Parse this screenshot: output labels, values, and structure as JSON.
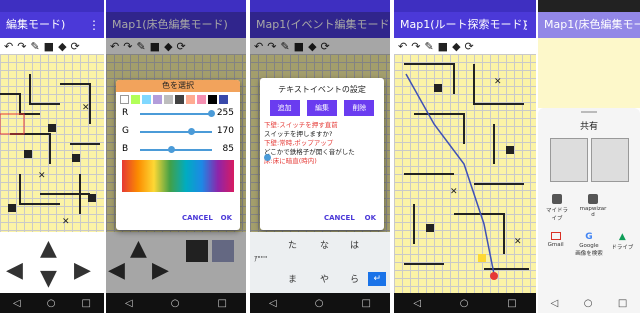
{
  "panels": {
    "p1": {
      "title": "編集モード)",
      "menu": "⋮"
    },
    "p2": {
      "title": "Map1(床色編集モード)",
      "dialog": {
        "title": "色を選択",
        "r_label": "R",
        "r_value": "255",
        "g_label": "G",
        "g_value": "170",
        "b_label": "B",
        "b_value": "85",
        "cancel": "CANCEL",
        "ok": "OK"
      }
    },
    "p3": {
      "title": "Map1(イベント編集モード)",
      "dialog": {
        "title": "テキストイベントの設定",
        "add": "追加",
        "edit": "編集",
        "delete": "削除",
        "lines": [
          "下壁:スイッチを押す直前",
          "スイッチを押しますか?",
          "下壁:常時,ポップアップ",
          "どこかで鉄格子が開く音がした",
          "床:床に暗直(時内)"
        ],
        "cancel": "CANCEL",
        "ok": "OK"
      },
      "keyboard": {
        "row1": [
          "た",
          "な",
          "は"
        ],
        "row2": [
          "ま",
          "や",
          "ら"
        ],
        "aux": "ｱ\"\"\"",
        "enter": "↵"
      }
    },
    "p4": {
      "title": "Map1(ルート探索モード)",
      "menu": "⋮"
    },
    "p5": {
      "title": "Map1(床色編集モード)",
      "share_title": "共有",
      "apps_row1": [
        {
          "label": "マイドラ\nイブ",
          "icon": "drive-icon"
        },
        {
          "label": "mapwizar\nd",
          "icon": "mapwizard-icon"
        }
      ],
      "apps_row2": [
        {
          "label": "Gmail",
          "icon": "gmail-icon"
        },
        {
          "label": "Google\n画像を検索",
          "icon": "google-icon"
        },
        {
          "label": "ドライブ",
          "icon": "drive-icon"
        }
      ]
    }
  }
}
